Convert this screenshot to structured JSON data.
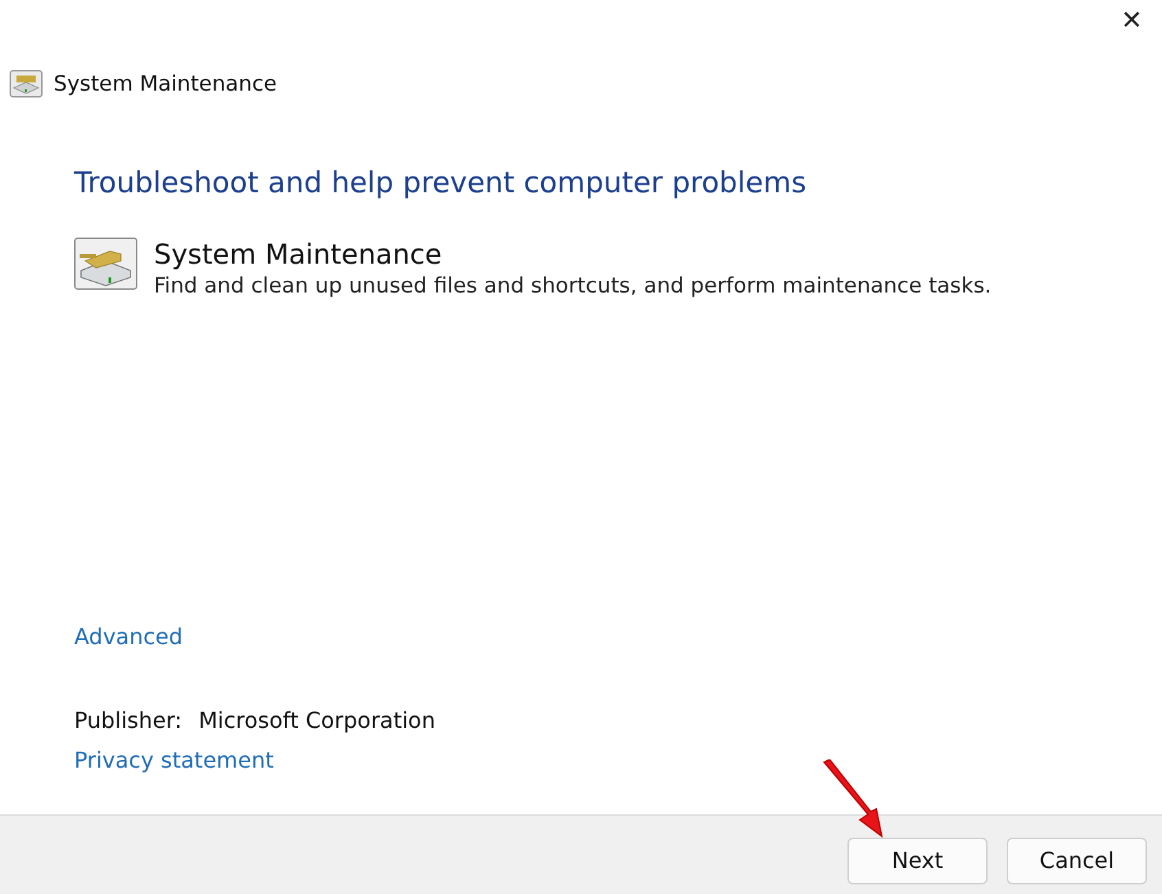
{
  "window": {
    "title": "System Maintenance",
    "close": "✕"
  },
  "heading": "Troubleshoot and help prevent computer problems",
  "troubleshooter": {
    "name": "System Maintenance",
    "description": "Find and clean up unused files and shortcuts, and perform maintenance tasks."
  },
  "advanced_link": "Advanced",
  "publisher": {
    "label": "Publisher:",
    "value": "Microsoft Corporation"
  },
  "privacy_link": "Privacy statement",
  "buttons": [
    {
      "label": "Next",
      "pointed": true
    },
    {
      "label": "Cancel",
      "pointed": false
    }
  ]
}
